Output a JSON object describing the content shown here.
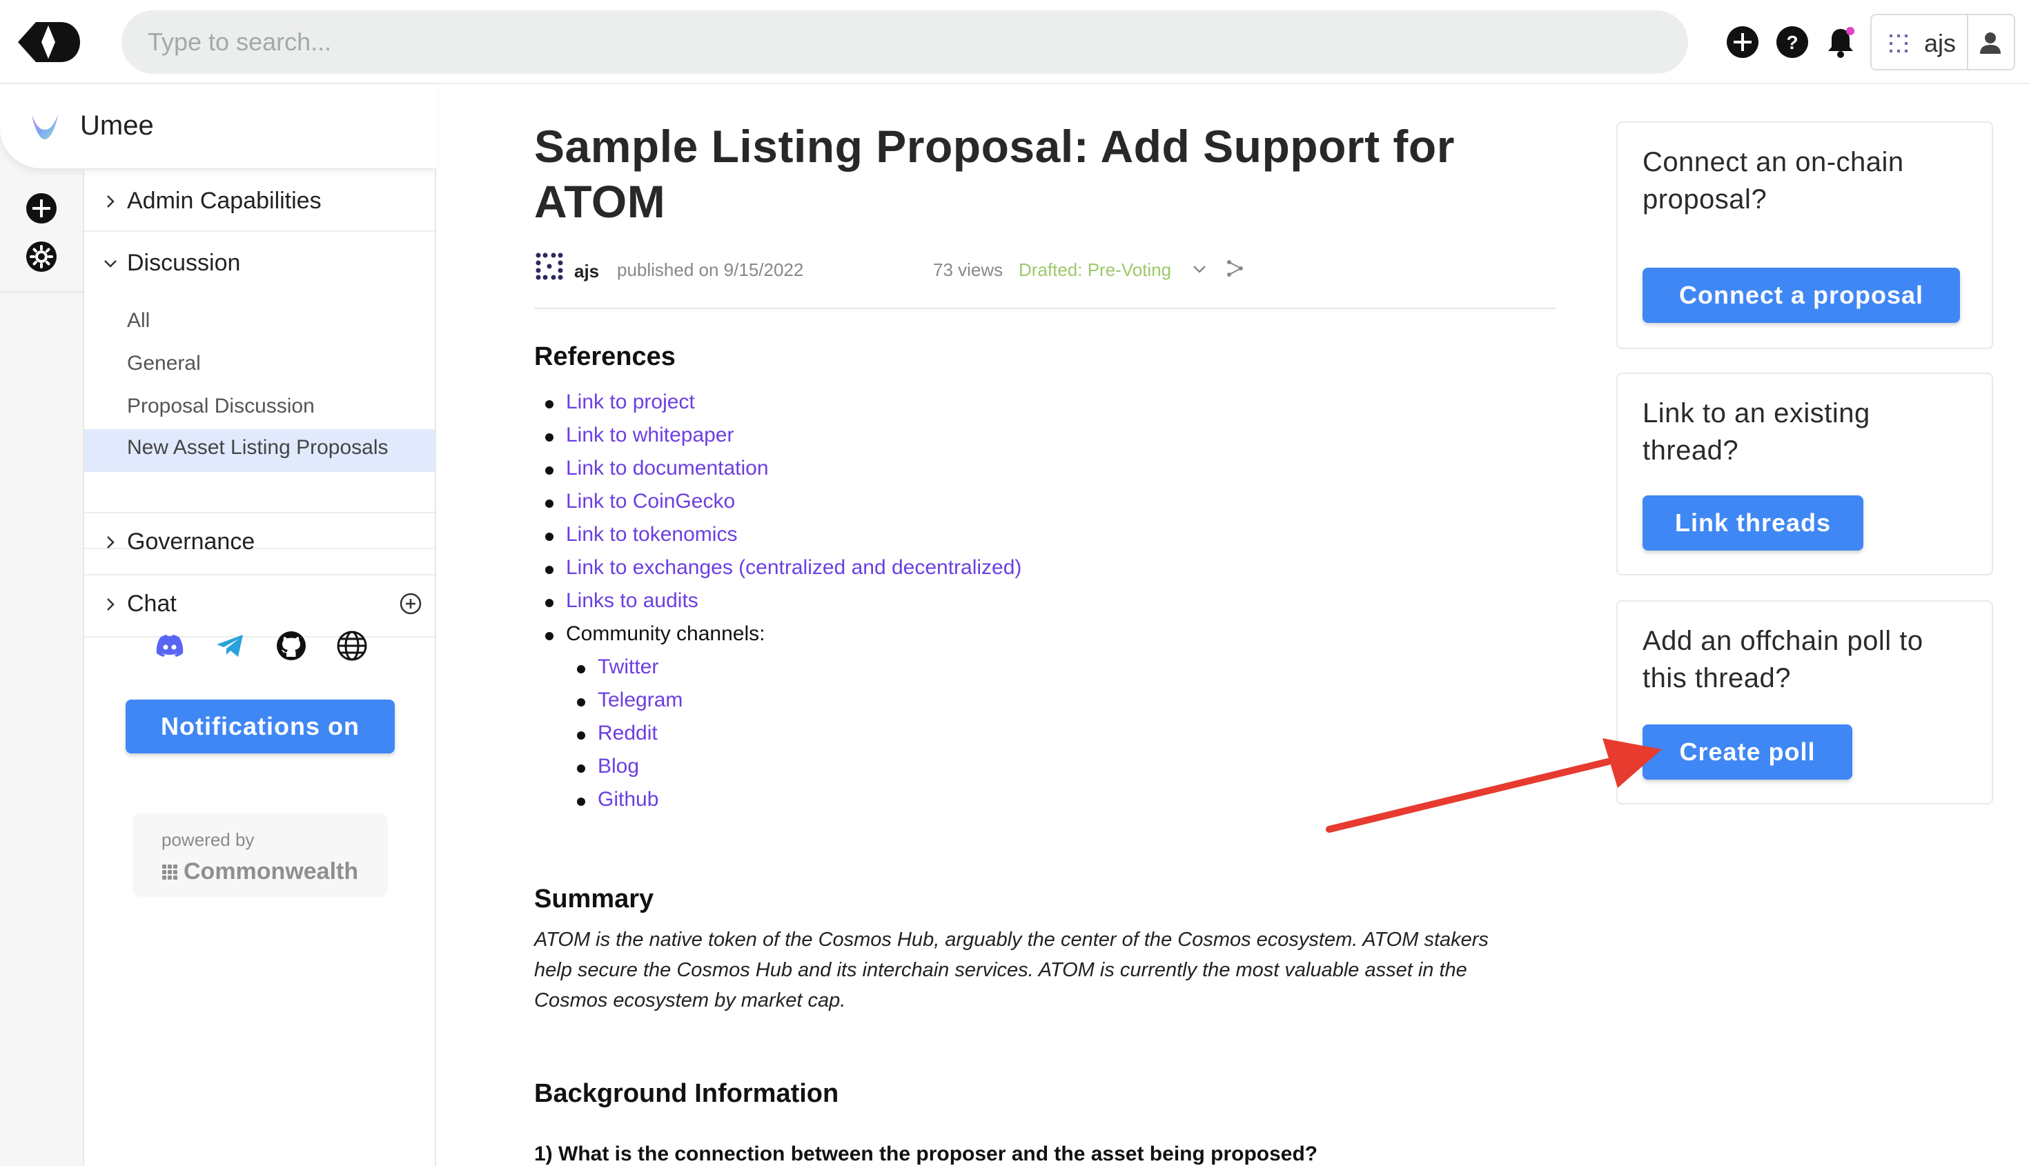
{
  "topbar": {
    "search_placeholder": "Type to search...",
    "user_name": "ajs"
  },
  "community": {
    "name": "Umee"
  },
  "sidebar": {
    "sections": [
      {
        "label": "Admin Capabilities",
        "expanded": false
      },
      {
        "label": "Discussion",
        "expanded": true
      },
      {
        "label": "Governance",
        "expanded": false
      },
      {
        "label": "Chat",
        "expanded": false
      }
    ],
    "discussion_items": [
      {
        "label": "All",
        "active": false
      },
      {
        "label": "General",
        "active": false
      },
      {
        "label": "Proposal Discussion",
        "active": false
      },
      {
        "label": "New Asset Listing Proposals",
        "active": true
      }
    ],
    "social_icons": [
      "discord-icon",
      "telegram-icon",
      "github-icon",
      "globe-icon"
    ],
    "notifications_button": "Notifications on",
    "powered_by": "powered by",
    "powered_brand": "Commonwealth"
  },
  "thread": {
    "title": "Sample Listing Proposal: Add Support for ATOM",
    "author": "ajs",
    "published": "published on 9/15/2022",
    "views": "73 views",
    "stage": "Drafted: Pre-Voting",
    "references_heading": "References",
    "references": [
      "Link to project",
      "Link to whitepaper",
      "Link to documentation",
      "Link to CoinGecko",
      "Link to tokenomics",
      "Link to exchanges (centralized and decentralized)",
      "Links to audits"
    ],
    "community_channels_label": "Community channels:",
    "community_channels": [
      "Twitter",
      "Telegram",
      "Reddit",
      "Blog",
      "Github"
    ],
    "summary_heading": "Summary",
    "summary_text": "ATOM is the native token of the Cosmos Hub, arguably the center of the Cosmos ecosystem. ATOM stakers help secure the Cosmos Hub and its interchain services. ATOM is currently the most valuable asset in the Cosmos ecosystem by market cap.",
    "background_heading": "Background Information",
    "question_1": "1) What is the connection between the proposer and the asset being proposed?"
  },
  "cards": [
    {
      "question": "Connect an on-chain proposal?",
      "button": "Connect a proposal"
    },
    {
      "question": "Link to an existing thread?",
      "button": "Link threads"
    },
    {
      "question": "Add an offchain poll to this thread?",
      "button": "Create poll"
    }
  ],
  "colors": {
    "accent_button": "#3f87f5",
    "link": "#6b3fe0",
    "stage_green": "#9ec86a",
    "active_item_bg": "#e1eafd",
    "annotation_arrow": "#e63b2e"
  }
}
